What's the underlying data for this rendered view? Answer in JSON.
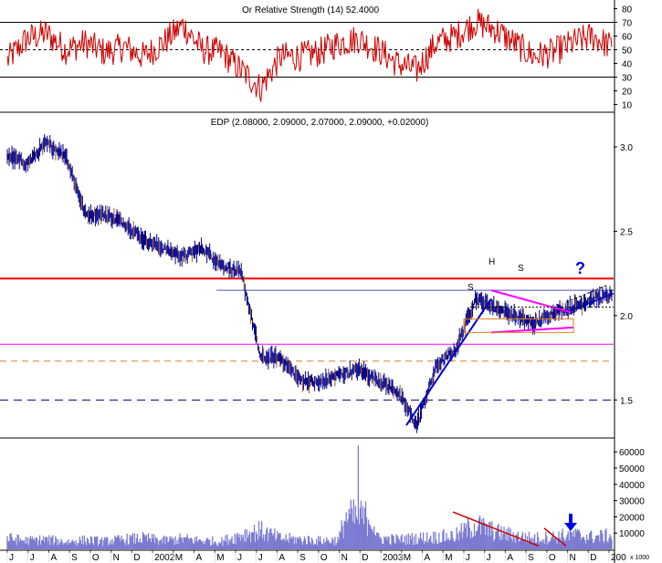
{
  "rsi_panel": {
    "title": "Or Relative Strength (14) 52.4000",
    "axis_ticks": [
      "80",
      "70",
      "60",
      "50",
      "40",
      "30",
      "20",
      "10"
    ],
    "overbought": 70,
    "oversold": 30,
    "midline": 50
  },
  "price_panel": {
    "title": "EDP (2.08000, 2.09000, 2.07000, 2.09000, +0.02000)",
    "axis_ticks": [
      "3.0",
      "2.5",
      "2.0",
      "1.5"
    ],
    "pattern_labels": [
      "S",
      "H",
      "S"
    ],
    "question_mark": "?"
  },
  "volume_panel": {
    "axis_ticks": [
      "60000",
      "50000",
      "40000",
      "30000",
      "20000",
      "10000"
    ],
    "unit_label": "x 1000"
  },
  "time_axis": {
    "labels": [
      "J",
      "J",
      "A",
      "S",
      "O",
      "N",
      "D",
      "2002",
      "M",
      "A",
      "M",
      "J",
      "J",
      "A",
      "S",
      "O",
      "N",
      "D",
      "2003",
      "M",
      "A",
      "M",
      "J",
      "J",
      "A",
      "S",
      "O",
      "N",
      "D",
      "200"
    ]
  },
  "colors": {
    "price_bars": "#00008b",
    "rsi_line": "#cc0000",
    "volume_bars": "#7b7bd1",
    "resistance": "#ff0000",
    "magenta": "#ff00ff",
    "orange_dash": "#e08020",
    "navy_dash": "#000080",
    "trendline": "#0000cc",
    "neckline": "#5050c0"
  },
  "chart_data": [
    {
      "type": "line",
      "name": "rsi",
      "ylim": [
        5,
        85
      ],
      "x": [
        "2001-06",
        "2001-07",
        "2001-08",
        "2001-09",
        "2001-10",
        "2001-11",
        "2001-12",
        "2002-01",
        "2002-02",
        "2002-03",
        "2002-04",
        "2002-05",
        "2002-06",
        "2002-07",
        "2002-08",
        "2002-09",
        "2002-10",
        "2002-11",
        "2002-12",
        "2003-01",
        "2003-02",
        "2003-03",
        "2003-04",
        "2003-05",
        "2003-06",
        "2003-07",
        "2003-08",
        "2003-09",
        "2003-10",
        "2003-11",
        "2003-12",
        "2004-01"
      ],
      "y": [
        42,
        58,
        62,
        50,
        55,
        48,
        52,
        45,
        55,
        68,
        50,
        48,
        35,
        22,
        45,
        45,
        48,
        55,
        58,
        50,
        40,
        35,
        55,
        60,
        70,
        65,
        55,
        45,
        48,
        55,
        60,
        52
      ]
    },
    {
      "type": "bar",
      "name": "price",
      "ylim": [
        1.28,
        3.2
      ],
      "x": [
        "2001-06",
        "2001-07",
        "2001-08",
        "2001-09",
        "2001-10",
        "2001-11",
        "2001-12",
        "2002-01",
        "2002-02",
        "2002-03",
        "2002-04",
        "2002-05",
        "2002-06",
        "2002-07",
        "2002-08",
        "2002-09",
        "2002-10",
        "2002-11",
        "2002-12",
        "2003-01",
        "2003-02",
        "2003-03",
        "2003-04",
        "2003-05",
        "2003-06",
        "2003-07",
        "2003-08",
        "2003-09",
        "2003-10",
        "2003-11",
        "2003-12",
        "2004-01"
      ],
      "y": [
        2.95,
        2.9,
        3.02,
        2.95,
        2.6,
        2.6,
        2.55,
        2.45,
        2.4,
        2.35,
        2.4,
        2.3,
        2.25,
        1.75,
        1.75,
        1.62,
        1.6,
        1.65,
        1.68,
        1.62,
        1.55,
        1.35,
        1.7,
        1.8,
        2.1,
        2.05,
        2.0,
        1.95,
        2.02,
        2.05,
        2.1,
        2.12
      ]
    },
    {
      "type": "bar",
      "name": "volume",
      "ylim": [
        0,
        68000
      ],
      "x": [
        "2001-06",
        "2001-07",
        "2001-08",
        "2001-09",
        "2001-10",
        "2001-11",
        "2001-12",
        "2002-01",
        "2002-02",
        "2002-03",
        "2002-04",
        "2002-05",
        "2002-06",
        "2002-07",
        "2002-08",
        "2002-09",
        "2002-10",
        "2002-11",
        "2002-12",
        "2003-01",
        "2003-02",
        "2003-03",
        "2003-04",
        "2003-05",
        "2003-06",
        "2003-07",
        "2003-08",
        "2003-09",
        "2003-10",
        "2003-11",
        "2003-12",
        "2004-01"
      ],
      "y": [
        9000,
        7000,
        8000,
        6000,
        7500,
        6500,
        8000,
        9000,
        7000,
        8500,
        7000,
        6500,
        12000,
        15000,
        9000,
        8000,
        7000,
        7500,
        64000,
        9000,
        8000,
        9000,
        10000,
        11000,
        20000,
        14000,
        11000,
        9000,
        10000,
        12000,
        10000,
        11000
      ]
    }
  ]
}
